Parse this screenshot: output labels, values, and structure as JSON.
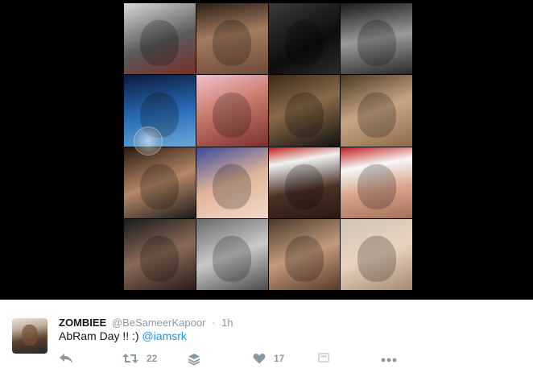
{
  "media": {
    "tiles": [
      "row1-col1",
      "row1-col2",
      "row1-col3",
      "row1-col4",
      "row2-col1",
      "row2-col2",
      "row2-col3",
      "row2-col4",
      "row3-col1",
      "row3-col2",
      "row3-col3",
      "row3-col4",
      "row4-col1",
      "row4-col2",
      "row4-col3",
      "row4-col4"
    ]
  },
  "tweet": {
    "display_name": "ZOMBIEE",
    "handle": "@BeSameerKapoor",
    "separator": "·",
    "time": "1h",
    "text_before_mention": "AbRam Day !! :) ",
    "mention": "@iamsrk"
  },
  "actions": {
    "retweet_count": "22",
    "like_count": "17",
    "icons": [
      "reply-icon",
      "retweet-icon",
      "stack-icon",
      "heart-icon",
      "card-icon",
      "more-icon"
    ]
  },
  "colors": {
    "media_background": "#000000",
    "name": "#14171a",
    "muted": "#8899a6",
    "link": "#1b95e0"
  }
}
